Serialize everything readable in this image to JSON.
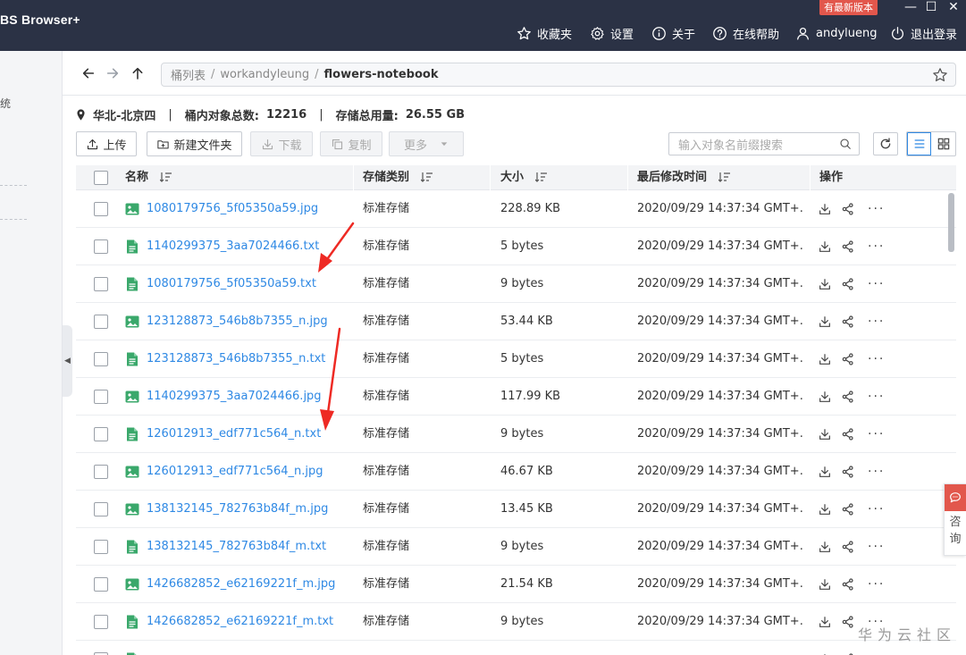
{
  "window": {
    "brand": "BS Browser+",
    "new_version_badge": "有最新版本",
    "minimize": "—",
    "maximize": "☐",
    "close": "✕"
  },
  "topnav": {
    "favorites": "收藏夹",
    "settings": "设置",
    "about": "关于",
    "help": "在线帮助",
    "user": "andylueng",
    "logout": "退出登录"
  },
  "sidebar": {
    "fragment": "统"
  },
  "breadcrumb": {
    "root": "桶列表",
    "sep": "/",
    "bucket": "workandyleung",
    "current": "flowers-notebook"
  },
  "info": {
    "region": "华北-北京四",
    "count_label": "桶内对象总数:",
    "count": "12216",
    "usage_label": "存储总用量:",
    "usage": "26.55 GB"
  },
  "toolbar": {
    "upload": "上传",
    "new_folder": "新建文件夹",
    "download": "下载",
    "copy": "复制",
    "more": "更多",
    "search_placeholder": "输入对象名前缀搜索"
  },
  "table": {
    "headers": {
      "name": "名称",
      "storage_class": "存储类别",
      "size": "大小",
      "modified": "最后修改时间",
      "actions": "操作"
    },
    "rows": [
      {
        "name": "1080179756_5f05350a59.jpg",
        "type": "image",
        "class": "标准存储",
        "size": "228.89 KB",
        "modified": "2020/09/29 14:37:34 GMT+..."
      },
      {
        "name": "1140299375_3aa7024466.txt",
        "type": "text",
        "class": "标准存储",
        "size": "5 bytes",
        "modified": "2020/09/29 14:37:34 GMT+..."
      },
      {
        "name": "1080179756_5f05350a59.txt",
        "type": "text",
        "class": "标准存储",
        "size": "9 bytes",
        "modified": "2020/09/29 14:37:34 GMT+..."
      },
      {
        "name": "123128873_546b8b7355_n.jpg",
        "type": "image",
        "class": "标准存储",
        "size": "53.44 KB",
        "modified": "2020/09/29 14:37:34 GMT+..."
      },
      {
        "name": "123128873_546b8b7355_n.txt",
        "type": "text",
        "class": "标准存储",
        "size": "5 bytes",
        "modified": "2020/09/29 14:37:34 GMT+..."
      },
      {
        "name": "1140299375_3aa7024466.jpg",
        "type": "image",
        "class": "标准存储",
        "size": "117.99 KB",
        "modified": "2020/09/29 14:37:34 GMT+..."
      },
      {
        "name": "126012913_edf771c564_n.txt",
        "type": "text",
        "class": "标准存储",
        "size": "9 bytes",
        "modified": "2020/09/29 14:37:34 GMT+..."
      },
      {
        "name": "126012913_edf771c564_n.jpg",
        "type": "image",
        "class": "标准存储",
        "size": "46.67 KB",
        "modified": "2020/09/29 14:37:34 GMT+..."
      },
      {
        "name": "138132145_782763b84f_m.jpg",
        "type": "image",
        "class": "标准存储",
        "size": "13.45 KB",
        "modified": "2020/09/29 14:37:34 GMT+..."
      },
      {
        "name": "138132145_782763b84f_m.txt",
        "type": "text",
        "class": "标准存储",
        "size": "9 bytes",
        "modified": "2020/09/29 14:37:34 GMT+..."
      },
      {
        "name": "1426682852_e62169221f_m.jpg",
        "type": "image",
        "class": "标准存储",
        "size": "21.54 KB",
        "modified": "2020/09/29 14:37:34 GMT+..."
      },
      {
        "name": "1426682852_e62169221f_m.txt",
        "type": "text",
        "class": "标准存储",
        "size": "9 bytes",
        "modified": "2020/09/29 14:37:34 GMT+..."
      },
      {
        "name": "",
        "type": "text",
        "class": "",
        "size": "",
        "modified": ""
      }
    ]
  },
  "consult": {
    "line1": "咨",
    "line2": "询"
  },
  "watermark": "华为云社区",
  "colors": {
    "topbar": "#2b3245",
    "accent": "#2f89e4",
    "badge": "#e2574c",
    "file_icon": "#3aa86b",
    "annotation_arrow": "#ee2a24"
  }
}
